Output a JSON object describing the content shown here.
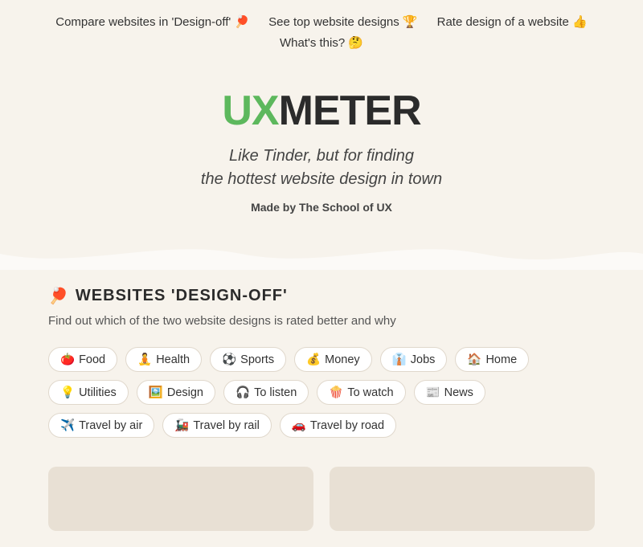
{
  "topnav": {
    "links": [
      {
        "id": "design-off",
        "label": "Compare websites in 'Design-off' 🏓"
      },
      {
        "id": "top-designs",
        "label": "See top website designs 🏆"
      },
      {
        "id": "rate-design",
        "label": "Rate design of a website 👍"
      },
      {
        "id": "whats-this",
        "label": "What's this? 🤔"
      }
    ]
  },
  "hero": {
    "logo_ux": "UX",
    "logo_meter": "METER",
    "tagline_line1": "Like Tinder, but for finding",
    "tagline_line2": "the hottest website design in town",
    "made_by_prefix": "Made by ",
    "made_by_org": "The School of UX"
  },
  "design_off_section": {
    "icon": "🏓",
    "heading": "WEBSITES 'DESIGN-OFF'",
    "subtext": "Find out which of the two website designs is rated better and why",
    "tags": [
      {
        "id": "food",
        "emoji": "🍅",
        "label": "Food"
      },
      {
        "id": "health",
        "emoji": "🧘",
        "label": "Health"
      },
      {
        "id": "sports",
        "emoji": "⚽",
        "label": "Sports"
      },
      {
        "id": "money",
        "emoji": "💰",
        "label": "Money"
      },
      {
        "id": "jobs",
        "emoji": "👔",
        "label": "Jobs"
      },
      {
        "id": "home",
        "emoji": "🏠",
        "label": "Home"
      },
      {
        "id": "utilities",
        "emoji": "💡",
        "label": "Utilities"
      },
      {
        "id": "design",
        "emoji": "🖼️",
        "label": "Design"
      },
      {
        "id": "to-listen",
        "emoji": "🎧",
        "label": "To listen"
      },
      {
        "id": "to-watch",
        "emoji": "🍿",
        "label": "To watch"
      },
      {
        "id": "news",
        "emoji": "📰",
        "label": "News"
      },
      {
        "id": "travel-by-air",
        "emoji": "✈️",
        "label": "Travel by air"
      },
      {
        "id": "travel-by-rail",
        "emoji": "🚂",
        "label": "Travel by rail"
      },
      {
        "id": "travel-by-road",
        "emoji": "🚗",
        "label": "Travel by road"
      }
    ]
  }
}
